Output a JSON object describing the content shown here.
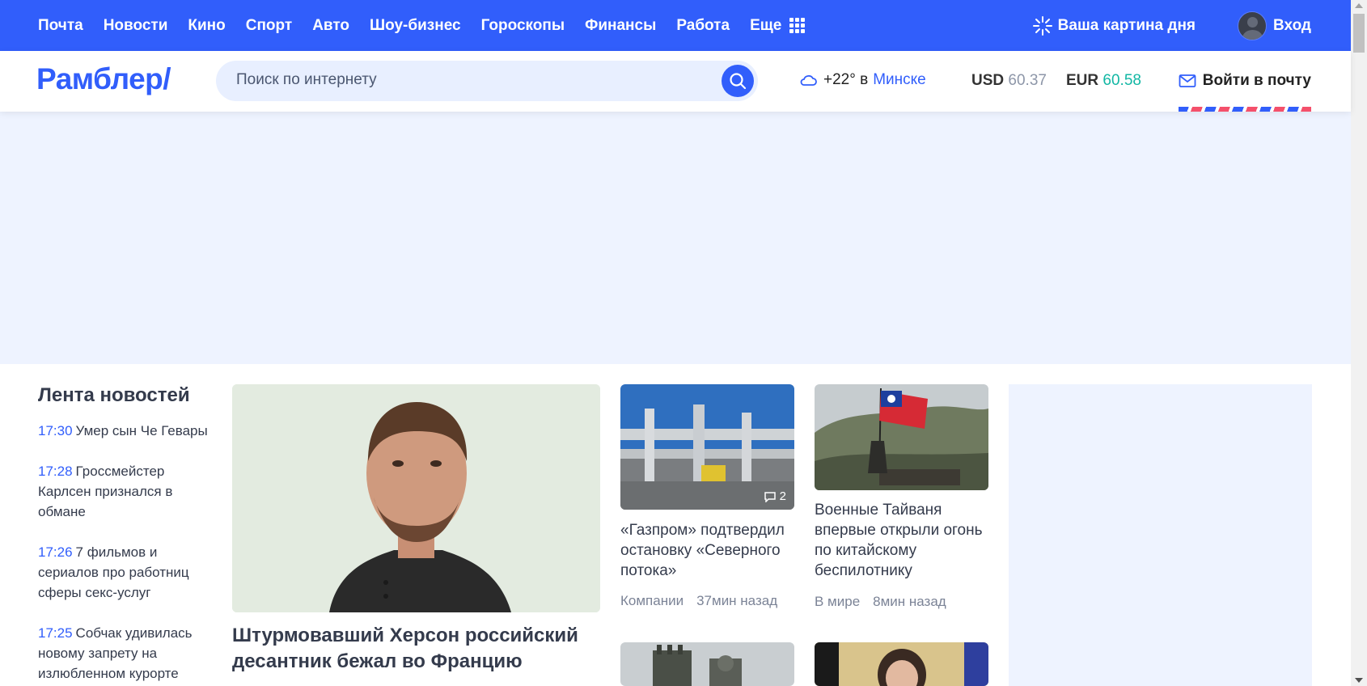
{
  "colors": {
    "brand": "#315efb",
    "banner_bg": "#eef3ff",
    "eur": "#12b7a4",
    "usd": "#8d96a8"
  },
  "topnav": {
    "links": [
      "Почта",
      "Новости",
      "Кино",
      "Спорт",
      "Авто",
      "Шоу-бизнес",
      "Гороскопы",
      "Финансы",
      "Работа"
    ],
    "more_label": "Еще",
    "more_icon": "grid-icon",
    "picture_of_day": "Ваша картина дня",
    "login_label": "Вход"
  },
  "header": {
    "logo": "Рамблер/",
    "search_placeholder": "Поиск по интернету",
    "weather": {
      "temp": "+22°",
      "preposition": "в",
      "city": "Минске",
      "icon": "cloud-icon"
    },
    "currency": {
      "usd_label": "USD",
      "usd_value": "60.37",
      "eur_label": "EUR",
      "eur_value": "60.58"
    },
    "mail_label": "Войти в почту"
  },
  "feed": {
    "title": "Лента новостей",
    "items": [
      {
        "time": "17:30",
        "text": "Умер сын Че Гевары"
      },
      {
        "time": "17:28",
        "text": "Гроссмейстер Карлсен признался в обмане"
      },
      {
        "time": "17:26",
        "text": "7 фильмов и сериалов про работниц сферы секс-услуг"
      },
      {
        "time": "17:25",
        "text": "Собчак удивилась новому запрету на излюбленном курорте"
      }
    ]
  },
  "main_article": {
    "title": "Штурмовавший Херсон российский десантник бежал во Францию"
  },
  "cards": [
    {
      "title": "«Газпром» подтвердил остановку «Северного потока»",
      "category": "Компании",
      "time": "37мин назад",
      "comments": "2"
    },
    {
      "title": "Военные Тайваня впервые открыли огонь по китайскому беспилотнику",
      "category": "В мире",
      "time": "8мин назад"
    }
  ]
}
